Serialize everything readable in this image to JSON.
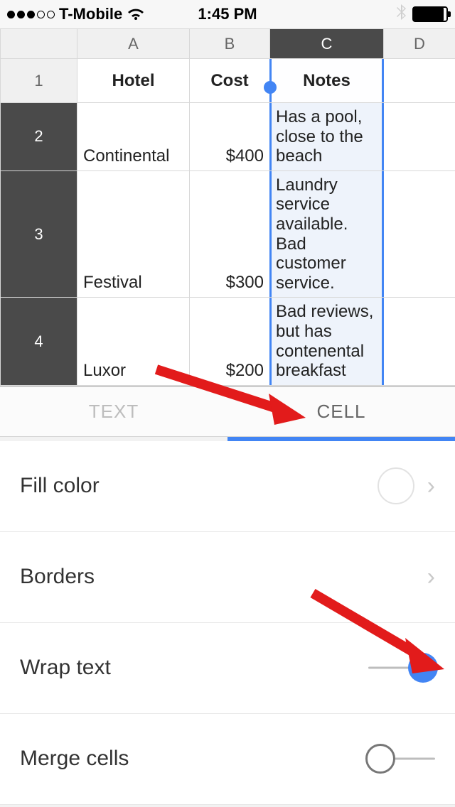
{
  "status": {
    "carrier": "T-Mobile",
    "time": "1:45 PM"
  },
  "columns": {
    "A": "A",
    "B": "B",
    "C": "C",
    "D": "D"
  },
  "rows": {
    "r1": "1",
    "r2": "2",
    "r3": "3",
    "r4": "4"
  },
  "headers": {
    "hotel": "Hotel",
    "cost": "Cost",
    "notes": "Notes"
  },
  "data": [
    {
      "hotel": "Continental",
      "cost": "$400",
      "notes": "Has a pool, close to the beach"
    },
    {
      "hotel": "Festival",
      "cost": "$300",
      "notes": "Laundry service available. Bad customer service."
    },
    {
      "hotel": "Luxor",
      "cost": "$200",
      "notes": "Bad reviews, but has contenental breakfast"
    }
  ],
  "tabs": {
    "text": "TEXT",
    "cell": "CELL",
    "active": "cell"
  },
  "options": {
    "fill_color": "Fill color",
    "borders": "Borders",
    "wrap_text": "Wrap text",
    "merge_cells": "Merge cells",
    "wrap_on": true,
    "merge_on": false
  }
}
